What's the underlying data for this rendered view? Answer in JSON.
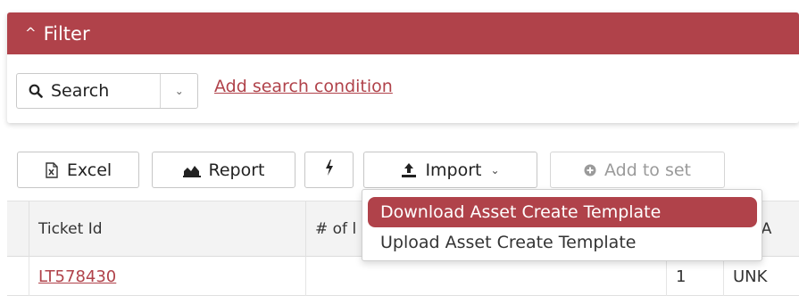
{
  "filter": {
    "title": "Filter",
    "search_label": "Search",
    "add_condition": "Add search condition"
  },
  "toolbar": {
    "excel": "Excel",
    "report": "Report",
    "import": "Import",
    "add_to_set": "Add to set"
  },
  "import_menu": {
    "items": [
      {
        "label": "Download Asset Create Template",
        "highlighted": true
      },
      {
        "label": "Upload Asset Create Template",
        "highlighted": false
      }
    ]
  },
  "table": {
    "columns": [
      "Ticket Id",
      "# of l",
      "",
      "ple/A"
    ],
    "rows": [
      {
        "ticket_id": "LT578430",
        "count": "",
        "qty": "1",
        "type": "UNK"
      }
    ]
  },
  "colors": {
    "accent": "#b0424a",
    "header_bg": "#f3f3f3",
    "disabled_text": "#9a9a9a"
  },
  "icons": {
    "filter_caret": "chevron-up-icon",
    "search": "search-icon",
    "excel": "excel-file-icon",
    "report": "area-chart-icon",
    "bolt": "bolt-icon",
    "import": "upload-icon",
    "add_to_set": "plus-circle-icon"
  }
}
